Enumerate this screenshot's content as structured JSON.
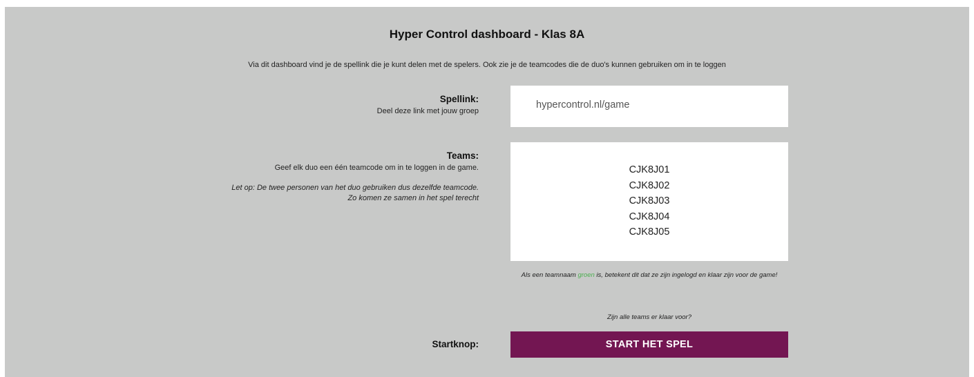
{
  "header": {
    "title": "Hyper Control dashboard - Klas 8A",
    "subtitle": "Via dit dashboard vind je de spellink die je kunt delen met de spelers. Ook zie je de teamcodes die de duo's kunnen gebruiken om in te loggen"
  },
  "game_link": {
    "label": "Spellink:",
    "description": "Deel deze link met jouw groep",
    "value": "hypercontrol.nl/game"
  },
  "teams": {
    "label": "Teams:",
    "description": "Geef elk duo een één teamcode om in te loggen in de game.",
    "note_line1": "Let op: De twee personen van het duo gebruiken dus dezelfde teamcode.",
    "note_line2": "Zo komen ze samen in het spel terecht",
    "codes": [
      "CJK8J01",
      "CJK8J02",
      "CJK8J03",
      "CJK8J04",
      "CJK8J05"
    ],
    "status_note_before": "Als een teamnaam ",
    "status_note_green": "groen",
    "status_note_after": " is, betekent dit dat ze zijn ingelogd en klaar zijn voor de game!",
    "green_color": "#4caf50"
  },
  "start": {
    "question": "Zijn alle teams er klaar voor?",
    "label": "Startknop:",
    "button_label": "START HET SPEL",
    "button_color": "#731652"
  }
}
